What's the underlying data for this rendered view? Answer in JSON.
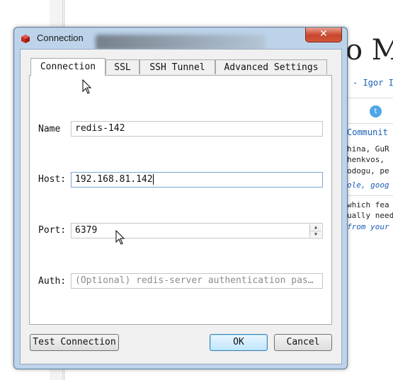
{
  "background": {
    "title_fragment": "o M",
    "author_fragment": "- Igor I",
    "community_heading": "Communit",
    "contributors_line1": "hina, GuR",
    "contributors_line2": "henkvos,",
    "contributors_line3": "odogu, pe",
    "links_line": "ole, goog",
    "text_line1": " which fea",
    "text_line2": "ually need",
    "text_line3": "from your",
    "twitter_icon": "twitter-icon"
  },
  "window": {
    "title": "Connection",
    "close_glyph": "✕",
    "app_icon": "redis-icon"
  },
  "tabs": [
    {
      "label": "Connection",
      "active": true
    },
    {
      "label": "SSL",
      "active": false
    },
    {
      "label": "SSH Tunnel",
      "active": false
    },
    {
      "label": "Advanced Settings",
      "active": false
    }
  ],
  "form": {
    "name_label": "Name",
    "name_value": "redis-142",
    "host_label": "Host:",
    "host_value": "192.168.81.142",
    "port_label": "Port:",
    "port_value": "6379",
    "auth_label": "Auth:",
    "auth_placeholder": "(Optional) redis-server authentication pas…"
  },
  "buttons": {
    "test": "Test Connection",
    "ok": "OK",
    "cancel": "Cancel"
  },
  "colors": {
    "window_frame": "#bcd3ea",
    "close_button": "#c7452b",
    "focus_border": "#7aa7d6",
    "default_button": "#3c7fb1"
  }
}
